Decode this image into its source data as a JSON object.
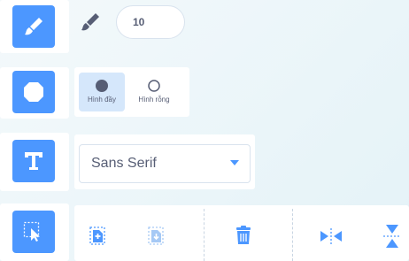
{
  "brush": {
    "tool_icon": "brush-icon",
    "size_icon": "brush-size-icon",
    "size_value": "10"
  },
  "fill": {
    "tool_icon": "octagon-shape-icon",
    "options": [
      {
        "label": "Hình đầy",
        "icon": "filled-circle-icon",
        "selected": true
      },
      {
        "label": "Hình rỗng",
        "icon": "outline-circle-icon",
        "selected": false
      }
    ]
  },
  "text": {
    "tool_icon": "text-t-icon",
    "font": "Sans Serif"
  },
  "select": {
    "tool_icon": "select-arrow-icon",
    "actions": [
      {
        "icon": "paste-icon"
      },
      {
        "icon": "paste-disabled-icon"
      },
      {
        "icon": "trash-icon"
      },
      {
        "icon": "flip-horizontal-icon"
      },
      {
        "icon": "flip-vertical-icon"
      }
    ]
  },
  "colors": {
    "accent": "#4c97ff",
    "text": "#575e75",
    "selected_bg": "#d5e7fb"
  }
}
